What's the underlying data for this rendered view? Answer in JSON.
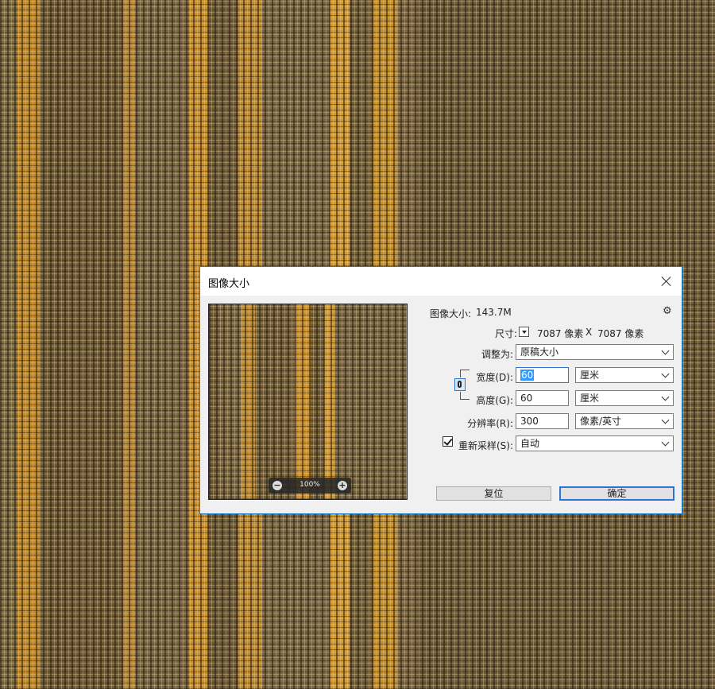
{
  "dialog": {
    "title": "图像大小",
    "image_size_label": "图像大小:",
    "image_size_value": "143.7M",
    "dimensions_label": "尺寸:",
    "dimensions_width": "7087 像素",
    "dimensions_sep": "X",
    "dimensions_height": "7087 像素",
    "fit_to_label": "调整为:",
    "fit_to_value": "原稿大小",
    "width_label": "宽度(D):",
    "width_value": "60",
    "width_unit": "厘米",
    "height_label": "高度(G):",
    "height_value": "60",
    "height_unit": "厘米",
    "resolution_label": "分辨率(R):",
    "resolution_value": "300",
    "resolution_unit": "像素/英寸",
    "resample_label": "重新采样(S):",
    "resample_checked": true,
    "resample_value": "自动",
    "reset_button": "复位",
    "ok_button": "确定"
  },
  "preview": {
    "zoom_label": "100%",
    "zoom_out": "−",
    "zoom_in": "+"
  },
  "icons": {
    "gear": "gear-icon",
    "close": "close-icon",
    "link": "chain-link-icon"
  },
  "colors": {
    "accent": "#2d74d2",
    "dialog_bg": "#f0f0f0"
  }
}
